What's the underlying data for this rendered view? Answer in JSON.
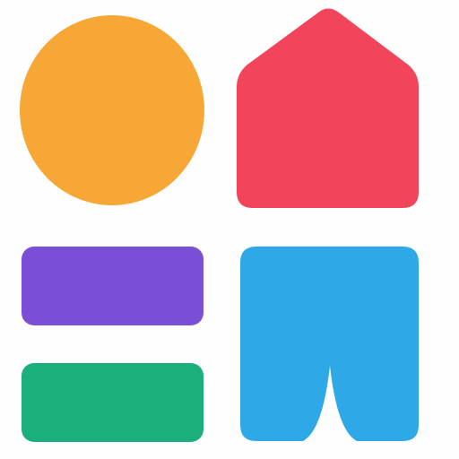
{
  "logo": {
    "colors": {
      "background": "#ffffff",
      "circle": "#f6a735",
      "house": "#f2445a",
      "purple_bar": "#7a4fd6",
      "green_bar": "#1bb07b",
      "blue_shape": "#2ea8e6"
    },
    "shapes": [
      "orange-circle",
      "red-house",
      "purple-bar",
      "green-bar",
      "blue-bookmark"
    ]
  }
}
